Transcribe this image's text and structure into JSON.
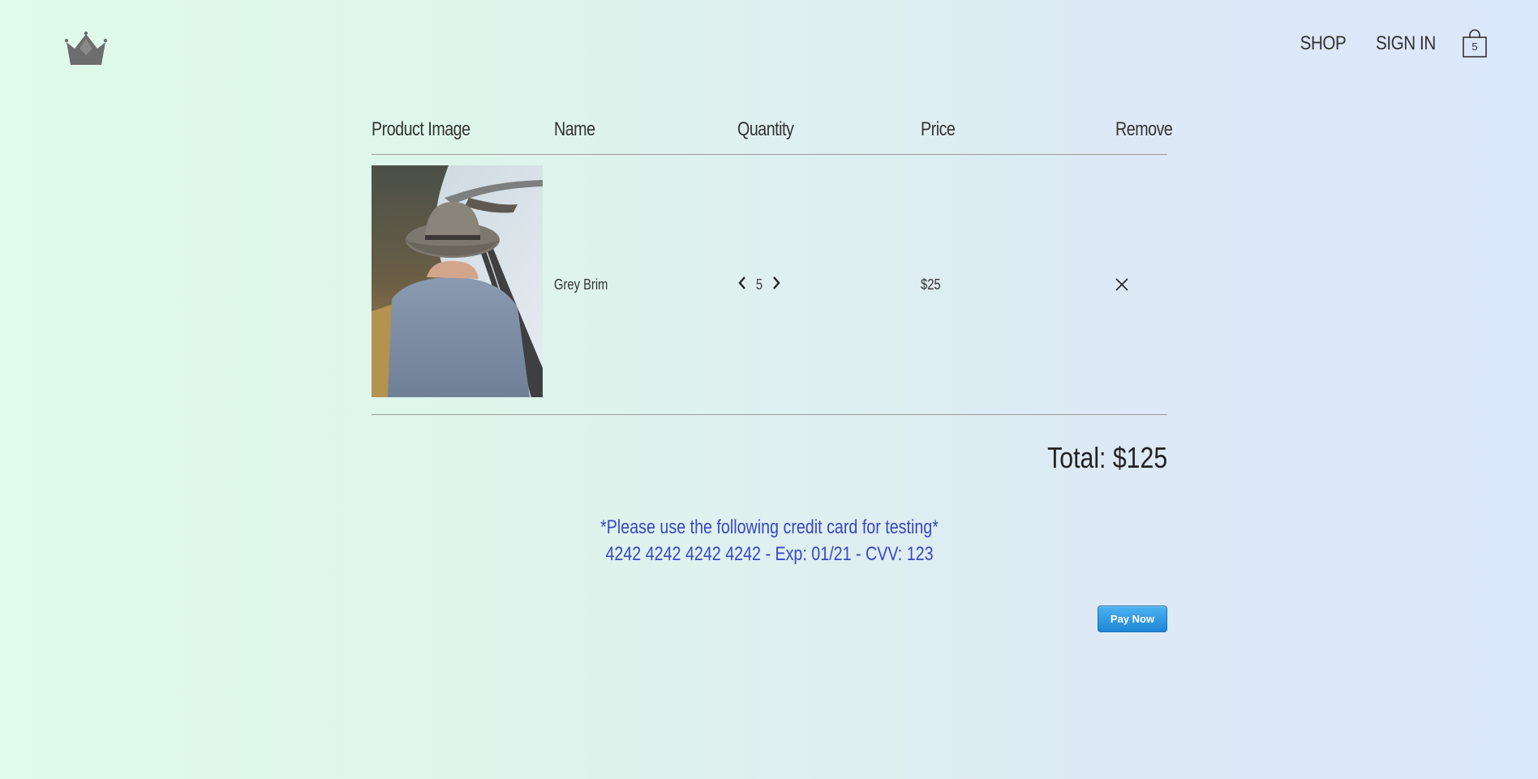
{
  "header": {
    "logo_icon": "crown-icon",
    "nav": {
      "shop": "SHOP",
      "sign_in": "SIGN IN"
    },
    "cart": {
      "icon": "shopping-bag-icon",
      "count": "5"
    }
  },
  "cart_table": {
    "columns": [
      "Product Image",
      "Name",
      "Quantity",
      "Price",
      "Remove"
    ],
    "items": [
      {
        "image": "man-in-grey-hat-photo",
        "name": "Grey Brim",
        "quantity": "5",
        "price": "$25",
        "decrease_icon": "chevron-left-icon",
        "increase_icon": "chevron-right-icon",
        "remove_icon": "close-icon"
      }
    ]
  },
  "total": "Total: $125",
  "testing_note": {
    "line1": "*Please use the following credit card for testing*",
    "line2": "4242 4242 4242 4242 - Exp: 01/21 - CVV: 123"
  },
  "pay_button": "Pay Now",
  "colors": {
    "accent_blue_text": "#3a46c6",
    "pay_button": "#1f86d6"
  }
}
